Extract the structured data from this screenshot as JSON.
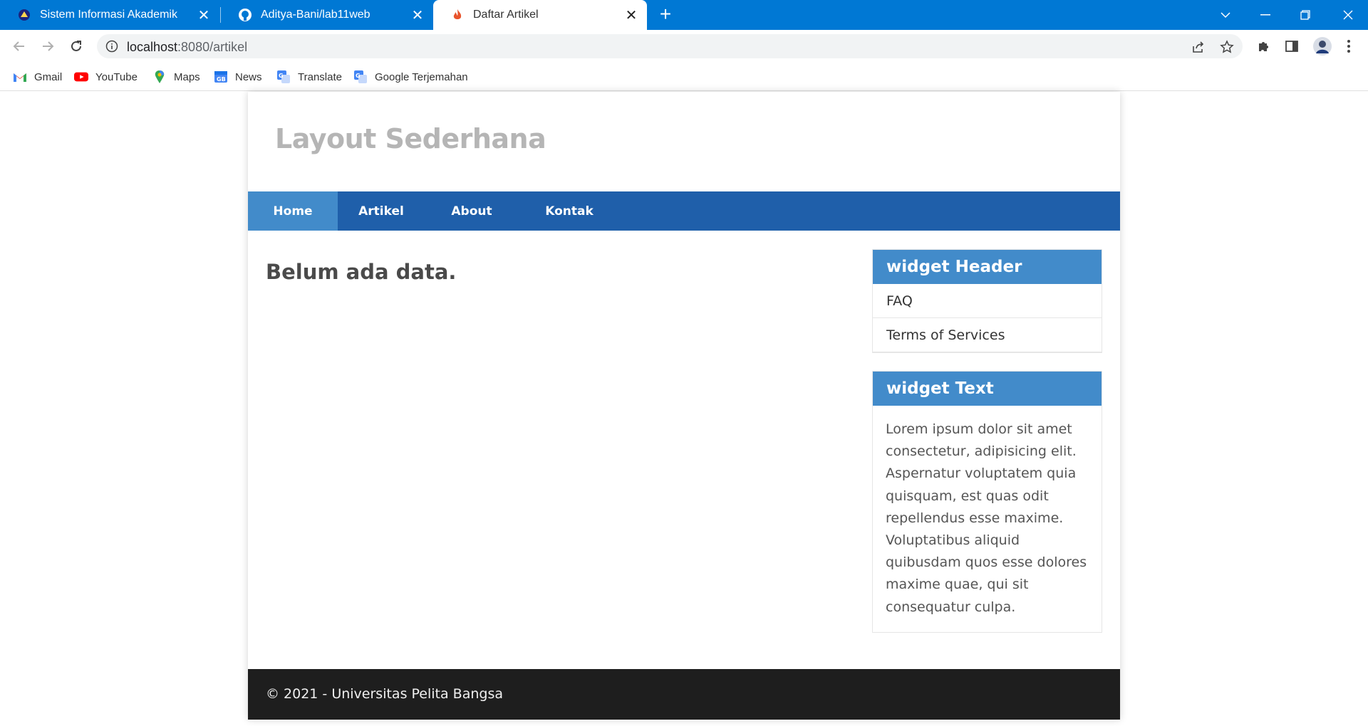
{
  "browser": {
    "tabs": [
      {
        "title": "Sistem Informasi Akademik",
        "icon": "university-icon",
        "active": false
      },
      {
        "title": "Aditya-Bani/lab11web",
        "icon": "github-icon",
        "active": false
      },
      {
        "title": "Daftar Artikel",
        "icon": "flame-icon",
        "active": true
      }
    ],
    "url_host": "localhost",
    "url_path": ":8080/artikel",
    "bookmarks": [
      {
        "label": "Gmail",
        "icon": "gmail-icon"
      },
      {
        "label": "YouTube",
        "icon": "youtube-icon"
      },
      {
        "label": "Maps",
        "icon": "maps-icon"
      },
      {
        "label": "News",
        "icon": "news-icon"
      },
      {
        "label": "Translate",
        "icon": "translate-icon"
      },
      {
        "label": "Google Terjemahan",
        "icon": "translate-icon"
      }
    ],
    "colors": {
      "titlebar": "#0078d4"
    }
  },
  "site": {
    "title": "Layout Sederhana",
    "nav": [
      {
        "label": "Home",
        "active": true
      },
      {
        "label": "Artikel",
        "active": false
      },
      {
        "label": "About",
        "active": false
      },
      {
        "label": "Kontak",
        "active": false
      }
    ],
    "content_message": "Belum ada data.",
    "widgets": {
      "header": {
        "title": "widget Header",
        "links": [
          "FAQ",
          "Terms of Services"
        ]
      },
      "text": {
        "title": "widget Text",
        "body": "Lorem ipsum dolor sit amet consectetur, adipisicing elit. Aspernatur voluptatem quia quisquam, est quas odit repellendus esse maxime. Voluptatibus aliquid quibusdam quos esse dolores maxime quae, qui sit consequatur culpa."
      }
    },
    "footer": "© 2021 - Universitas Pelita Bangsa",
    "colors": {
      "nav": "#1f5faa",
      "accent": "#428bca",
      "footer": "#1e1e1e",
      "title": "#b5b5b5"
    }
  }
}
